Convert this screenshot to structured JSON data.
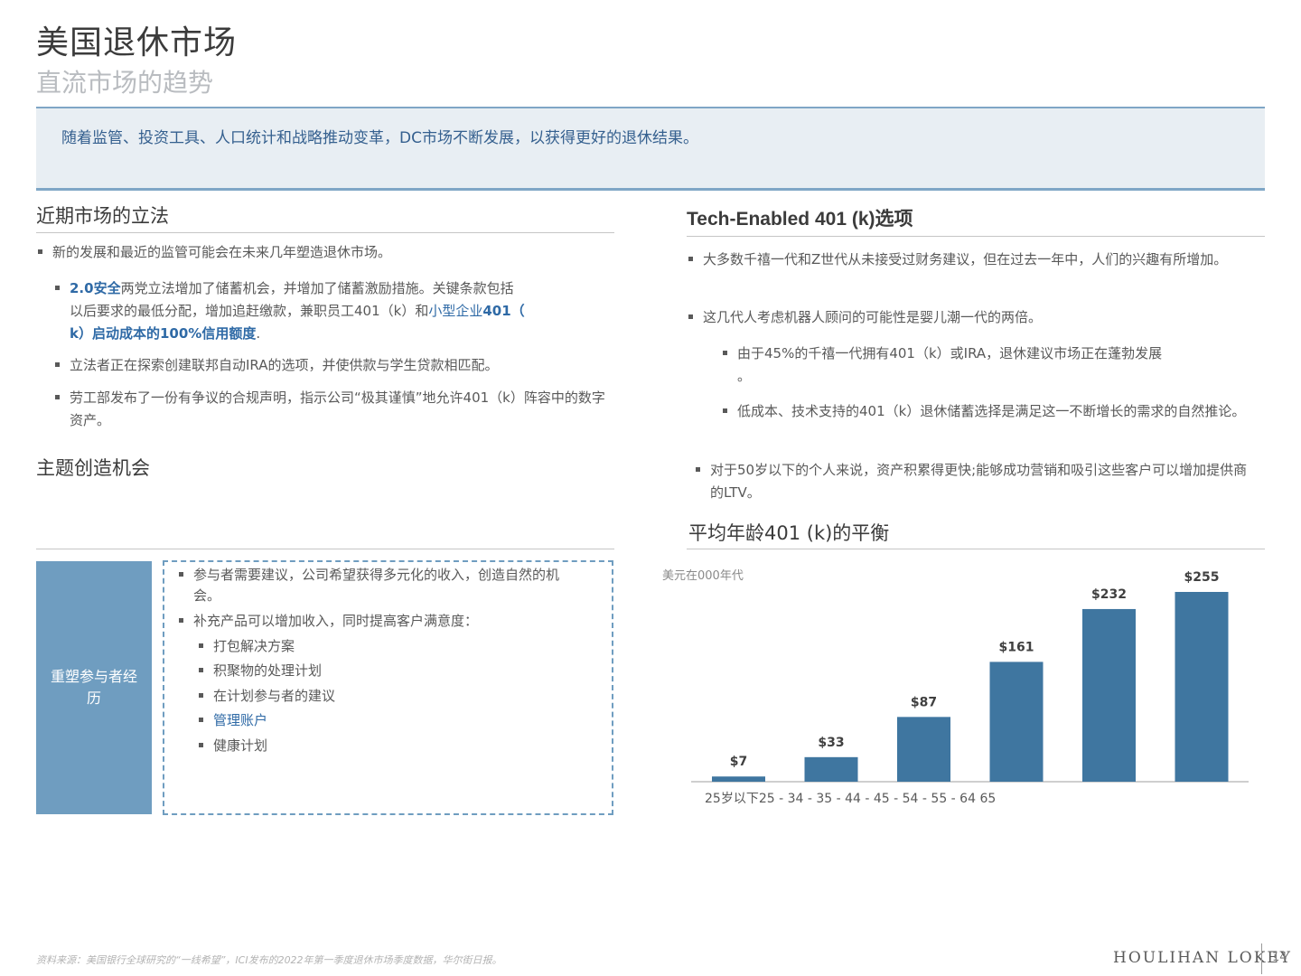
{
  "header": {
    "title": "美国退休市场",
    "subtitle": "直流市场的趋势"
  },
  "banner": {
    "text": "随着监管、投资工具、人口统计和战略推动变革，DC市场不断发展，以获得更好的退休结果。"
  },
  "left": {
    "legislation_title": "近期市场的立法",
    "legislation_intro": "新的发展和最近的监管可能会在未来几年塑造退休市场。",
    "secure_bullet": {
      "link1": "2.0安全",
      "part1": "两党立法增加了储蓄机会，并增加了储蓄激励措施。关键条款包括",
      "part2": "以后要求的最低分配，增加追赶缴款，兼职员工401（k）和",
      "link2a": "小型企业",
      "link2b": "401（",
      "link3": "k）启动成本的100%信用额度",
      "end": "."
    },
    "bullet_ira": "立法者正在探索创建联邦自动IRA的选项，并使供款与学生贷款相匹配。",
    "bullet_dol": "劳工部发布了一份有争议的合规声明，指示公司“极其谨慎”地允许401（k）阵容中的数字资产。",
    "theme_title": "主题创造机会",
    "opportunity": {
      "label": "重塑参与者经历",
      "bullets": [
        "参与者需要建议，公司希望获得多元化的收入，创造自然的机会。",
        "补充产品可以增加收入，同时提高客户满意度："
      ],
      "sub_bullets": [
        "打包解决方案",
        "积聚物的处理计划",
        "在计划参与者的建议",
        "管理账户",
        "健康计划"
      ]
    }
  },
  "right": {
    "tech_title": "Tech-Enabled 401 (k)选项",
    "bullet_1": "大多数千禧一代和Z世代从未接受过财务建议，但在过去一年中，人们的兴趣有所增加。",
    "bullet_2": "这几代人考虑机器人顾问的可能性是婴儿潮一代的两倍。",
    "sub_1": "由于45%的千禧一代拥有401（k）或IRA，退休建议市场正在蓬勃发展",
    "sub_1b": "。",
    "sub_2": "低成本、技术支持的401（k）退休储蓄选择是满足这一不断增长的需求的自然推论。",
    "bullet_3": "对于50岁以下的个人来说，资产积累得更快;能够成功营销和吸引这些客户可以增加提供商的LTV。",
    "chart_title": "平均年龄401 (k)的平衡"
  },
  "chart_data": {
    "type": "bar",
    "title": "平均年龄401 (k)的平衡",
    "unit_label": "美元在000年代",
    "x_axis_label": "25岁以下25 - 34 - 35 - 44 - 45 - 54 - 55 - 64 65",
    "values": [
      7,
      33,
      87,
      161,
      232,
      255
    ],
    "data_labels": [
      "$7",
      "$33",
      "$87",
      "$161",
      "$232",
      "$255"
    ],
    "ylim": [
      0,
      255
    ],
    "color": "#3f76a0",
    "grid": false
  },
  "footer": {
    "source": "资料来源：美国银行全球研究的“一线希望”，ICI发布的2022年第一季度退休市场季度数据，华尔街日报。",
    "logo": "HOULIHAN LOKEY",
    "page": "14"
  },
  "colors": {
    "accent": "#6f9dc0",
    "link": "#2f6aa6",
    "bar": "#3f76a0",
    "banner_bg": "#e8eef3"
  }
}
